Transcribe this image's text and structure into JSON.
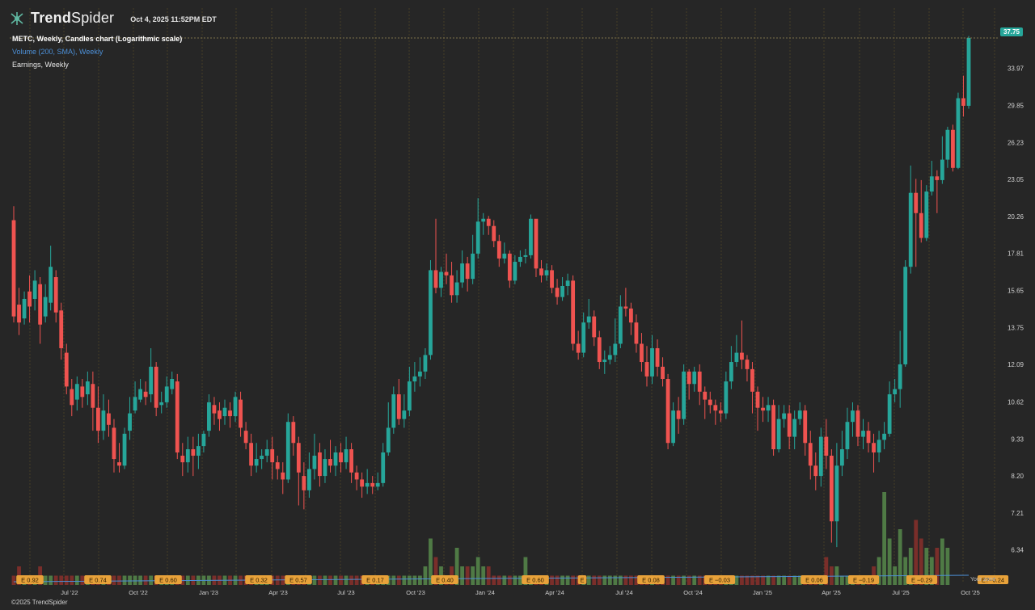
{
  "app": {
    "brand_bold": "Trend",
    "brand_light": "Spider",
    "timestamp": "Oct 4, 2025 11:52PM EDT",
    "copyright": "©2025 TrendSpider",
    "your_zone": "Your zone"
  },
  "legend": {
    "main": "METC, Weekly, Candles chart (Logarithmic scale)",
    "volume": "Volume (200, SMA), Weekly",
    "earnings": "Earnings, Weekly"
  },
  "colors": {
    "up": "#26a69a",
    "down": "#ef5350",
    "background": "#262626",
    "grid": "#6b5a2a",
    "volume_up": "#4f7a45",
    "volume_down": "#7a2e2a",
    "earnings_badge": "#e8a23a"
  },
  "chart_data": {
    "type": "candlestick",
    "symbol": "METC",
    "interval": "Weekly",
    "scale": "log",
    "last_price": "37.75",
    "y_ticks": [
      "37.75",
      "33.97",
      "29.85",
      "26.23",
      "23.05",
      "20.26",
      "17.81",
      "15.65",
      "13.75",
      "12.09",
      "10.62",
      "9.33",
      "8.20",
      "7.21",
      "6.34"
    ],
    "x_ticks": [
      "Jul '22",
      "Oct '22",
      "Jan '23",
      "Apr '23",
      "Jul '23",
      "Oct '23",
      "Jan '24",
      "Apr '24",
      "Jul '24",
      "Oct '24",
      "Jan '25",
      "Apr '25",
      "Jul '25",
      "Oct '25"
    ],
    "y_range": [
      6.0,
      38.5
    ],
    "candles": [
      [
        20.0,
        14.3,
        21.0,
        14.0
      ],
      [
        14.9,
        14.0,
        15.8,
        13.4
      ],
      [
        14.2,
        15.2,
        15.6,
        13.9
      ],
      [
        15.6,
        14.8,
        16.5,
        14.0
      ],
      [
        15.2,
        16.2,
        16.8,
        14.6
      ],
      [
        16.0,
        13.9,
        16.4,
        13.0
      ],
      [
        14.3,
        15.3,
        16.0,
        14.0
      ],
      [
        15.0,
        17.0,
        18.3,
        14.6
      ],
      [
        16.4,
        14.5,
        16.8,
        14.0
      ],
      [
        14.6,
        12.8,
        15.0,
        12.3
      ],
      [
        12.6,
        11.2,
        13.0,
        10.9
      ],
      [
        11.1,
        10.5,
        11.5,
        10.1
      ],
      [
        10.7,
        11.3,
        11.6,
        10.3
      ],
      [
        11.2,
        10.8,
        11.5,
        10.4
      ],
      [
        10.9,
        11.4,
        11.8,
        10.5
      ],
      [
        11.3,
        10.4,
        11.8,
        9.6
      ],
      [
        10.4,
        9.6,
        11.2,
        9.2
      ],
      [
        9.6,
        10.3,
        10.9,
        9.3
      ],
      [
        10.2,
        9.8,
        10.7,
        9.4
      ],
      [
        9.7,
        8.7,
        10.0,
        8.3
      ],
      [
        8.6,
        8.5,
        9.2,
        8.3
      ],
      [
        8.5,
        9.5,
        9.7,
        8.4
      ],
      [
        9.6,
        10.2,
        10.8,
        9.3
      ],
      [
        10.3,
        10.8,
        11.4,
        10.2
      ],
      [
        10.7,
        11.1,
        11.5,
        10.6
      ],
      [
        11.0,
        10.8,
        11.4,
        10.5
      ],
      [
        10.9,
        12.0,
        12.8,
        10.6
      ],
      [
        12.0,
        10.4,
        12.2,
        10.1
      ],
      [
        10.5,
        10.6,
        11.0,
        10.2
      ],
      [
        10.6,
        11.2,
        11.6,
        10.4
      ],
      [
        11.1,
        11.5,
        11.8,
        10.9
      ],
      [
        11.4,
        8.9,
        11.7,
        8.7
      ],
      [
        8.8,
        8.6,
        9.2,
        8.2
      ],
      [
        8.6,
        9.0,
        9.4,
        8.3
      ],
      [
        9.0,
        8.8,
        9.4,
        8.2
      ],
      [
        8.8,
        9.1,
        9.5,
        8.4
      ],
      [
        9.1,
        9.5,
        9.6,
        8.9
      ],
      [
        9.6,
        10.6,
        10.9,
        9.4
      ],
      [
        10.5,
        10.2,
        10.8,
        9.8
      ],
      [
        10.3,
        10.0,
        10.6,
        9.6
      ],
      [
        10.1,
        10.4,
        10.7,
        9.8
      ],
      [
        10.3,
        10.1,
        10.6,
        9.7
      ],
      [
        10.1,
        10.8,
        11.0,
        9.9
      ],
      [
        10.7,
        9.7,
        11.0,
        9.4
      ],
      [
        9.6,
        9.2,
        9.9,
        9.0
      ],
      [
        9.2,
        8.5,
        9.5,
        8.2
      ],
      [
        8.5,
        8.7,
        9.2,
        8.3
      ],
      [
        8.7,
        8.8,
        9.0,
        8.4
      ],
      [
        8.8,
        9.0,
        9.3,
        8.6
      ],
      [
        9.0,
        8.6,
        9.4,
        8.1
      ],
      [
        8.6,
        8.4,
        8.8,
        8.1
      ],
      [
        8.3,
        8.1,
        8.6,
        7.7
      ],
      [
        8.1,
        9.9,
        10.2,
        8.0
      ],
      [
        9.9,
        9.2,
        10.1,
        8.8
      ],
      [
        9.2,
        8.3,
        9.4,
        7.4
      ],
      [
        8.2,
        7.8,
        8.6,
        7.3
      ],
      [
        7.8,
        8.4,
        8.9,
        7.6
      ],
      [
        8.4,
        8.8,
        9.5,
        8.1
      ],
      [
        8.9,
        8.2,
        9.2,
        7.9
      ],
      [
        8.2,
        8.7,
        9.0,
        8.0
      ],
      [
        8.7,
        8.5,
        9.3,
        8.3
      ],
      [
        8.5,
        8.9,
        9.1,
        8.2
      ],
      [
        8.9,
        8.6,
        9.2,
        8.3
      ],
      [
        8.6,
        9.0,
        9.4,
        8.4
      ],
      [
        9.0,
        8.3,
        9.2,
        8.0
      ],
      [
        8.3,
        8.1,
        8.5,
        7.8
      ],
      [
        8.1,
        7.9,
        8.3,
        7.6
      ],
      [
        7.9,
        8.0,
        8.4,
        7.7
      ],
      [
        8.0,
        7.9,
        8.2,
        7.7
      ],
      [
        7.9,
        8.0,
        8.3,
        7.8
      ],
      [
        8.0,
        8.9,
        9.2,
        7.9
      ],
      [
        8.9,
        9.7,
        10.6,
        8.8
      ],
      [
        9.7,
        10.9,
        11.2,
        9.5
      ],
      [
        10.9,
        10.0,
        11.5,
        9.8
      ],
      [
        10.0,
        10.3,
        10.9,
        9.7
      ],
      [
        10.3,
        11.4,
        12.0,
        10.1
      ],
      [
        11.4,
        11.6,
        12.2,
        11.0
      ],
      [
        11.6,
        11.8,
        12.4,
        11.2
      ],
      [
        11.8,
        12.5,
        12.8,
        11.5
      ],
      [
        12.5,
        16.8,
        17.4,
        12.3
      ],
      [
        16.8,
        15.8,
        20.1,
        15.5
      ],
      [
        15.8,
        16.7,
        17.0,
        15.3
      ],
      [
        16.7,
        16.5,
        17.8,
        16.0
      ],
      [
        16.5,
        15.4,
        17.3,
        15.0
      ],
      [
        15.4,
        16.1,
        16.8,
        15.0
      ],
      [
        16.1,
        17.2,
        18.0,
        15.8
      ],
      [
        17.2,
        16.3,
        17.6,
        15.6
      ],
      [
        16.3,
        17.8,
        19.0,
        16.0
      ],
      [
        17.8,
        19.9,
        21.6,
        17.5
      ],
      [
        19.9,
        20.1,
        20.5,
        19.0
      ],
      [
        20.1,
        19.6,
        20.3,
        19.0
      ],
      [
        19.6,
        18.6,
        20.0,
        18.2
      ],
      [
        18.6,
        17.5,
        19.0,
        17.0
      ],
      [
        17.5,
        17.8,
        18.5,
        17.2
      ],
      [
        17.8,
        16.2,
        18.0,
        15.8
      ],
      [
        16.2,
        17.3,
        17.7,
        16.0
      ],
      [
        17.3,
        17.6,
        18.0,
        17.0
      ],
      [
        17.6,
        17.7,
        18.1,
        17.2
      ],
      [
        17.7,
        20.1,
        20.4,
        17.5
      ],
      [
        20.1,
        16.9,
        20.0,
        16.4
      ],
      [
        16.9,
        16.5,
        17.4,
        16.1
      ],
      [
        16.5,
        16.8,
        17.2,
        16.2
      ],
      [
        16.8,
        15.8,
        17.1,
        15.5
      ],
      [
        15.8,
        15.3,
        16.3,
        14.9
      ],
      [
        15.3,
        15.9,
        16.4,
        15.1
      ],
      [
        15.9,
        16.2,
        16.6,
        15.4
      ],
      [
        16.2,
        13.0,
        16.5,
        12.7
      ],
      [
        13.0,
        12.6,
        13.6,
        12.3
      ],
      [
        12.6,
        14.0,
        14.5,
        12.4
      ],
      [
        14.0,
        14.3,
        15.2,
        13.7
      ],
      [
        14.3,
        13.3,
        14.6,
        12.9
      ],
      [
        13.3,
        12.2,
        13.6,
        11.9
      ],
      [
        12.2,
        12.3,
        12.7,
        11.7
      ],
      [
        12.3,
        12.5,
        12.9,
        12.1
      ],
      [
        12.5,
        13.0,
        14.2,
        12.2
      ],
      [
        13.0,
        14.8,
        15.4,
        12.8
      ],
      [
        14.8,
        14.7,
        15.8,
        14.3
      ],
      [
        14.7,
        14.0,
        15.0,
        13.4
      ],
      [
        14.0,
        13.0,
        14.4,
        12.6
      ],
      [
        13.0,
        12.2,
        13.5,
        11.8
      ],
      [
        12.2,
        11.6,
        12.9,
        11.2
      ],
      [
        11.6,
        12.8,
        13.4,
        11.3
      ],
      [
        12.8,
        12.0,
        13.2,
        11.6
      ],
      [
        12.0,
        11.5,
        12.4,
        11.2
      ],
      [
        11.5,
        9.2,
        11.7,
        9.0
      ],
      [
        9.2,
        10.3,
        10.6,
        9.1
      ],
      [
        10.3,
        10.0,
        10.8,
        9.5
      ],
      [
        10.0,
        11.8,
        12.1,
        9.8
      ],
      [
        11.8,
        11.3,
        11.9,
        10.7
      ],
      [
        11.3,
        11.8,
        12.0,
        11.0
      ],
      [
        11.8,
        11.0,
        12.1,
        10.5
      ],
      [
        11.0,
        10.7,
        11.2,
        10.0
      ],
      [
        10.7,
        10.5,
        11.0,
        10.2
      ],
      [
        10.5,
        10.3,
        10.7,
        9.8
      ],
      [
        10.3,
        10.2,
        10.6,
        9.9
      ],
      [
        10.2,
        11.4,
        11.8,
        10.0
      ],
      [
        11.4,
        12.2,
        12.9,
        11.1
      ],
      [
        12.2,
        12.6,
        13.4,
        12.0
      ],
      [
        12.6,
        12.3,
        14.1,
        11.9
      ],
      [
        12.3,
        11.9,
        12.5,
        11.4
      ],
      [
        11.9,
        11.0,
        12.2,
        10.2
      ],
      [
        11.0,
        10.4,
        11.2,
        9.6
      ],
      [
        10.4,
        10.3,
        10.8,
        9.9
      ],
      [
        10.3,
        10.5,
        10.8,
        9.9
      ],
      [
        10.5,
        9.0,
        10.7,
        8.8
      ],
      [
        9.0,
        10.0,
        10.5,
        8.9
      ],
      [
        10.0,
        10.2,
        10.5,
        9.7
      ],
      [
        10.2,
        9.4,
        10.5,
        9.0
      ],
      [
        9.4,
        10.0,
        10.3,
        9.0
      ],
      [
        10.0,
        10.3,
        10.6,
        9.8
      ],
      [
        10.3,
        9.2,
        10.5,
        8.8
      ],
      [
        9.2,
        8.5,
        9.6,
        8.1
      ],
      [
        8.5,
        8.2,
        8.9,
        7.8
      ],
      [
        8.2,
        9.4,
        9.7,
        7.9
      ],
      [
        9.4,
        8.8,
        10.0,
        8.4
      ],
      [
        8.8,
        7.0,
        9.0,
        6.5
      ],
      [
        7.0,
        8.5,
        9.2,
        6.4
      ],
      [
        8.5,
        9.0,
        9.6,
        8.2
      ],
      [
        9.0,
        9.9,
        10.4,
        8.7
      ],
      [
        9.9,
        10.3,
        10.6,
        9.4
      ],
      [
        10.3,
        9.4,
        10.5,
        9.1
      ],
      [
        9.4,
        9.6,
        10.0,
        9.0
      ],
      [
        9.6,
        9.2,
        9.9,
        8.9
      ],
      [
        9.2,
        8.9,
        9.5,
        8.3
      ],
      [
        8.9,
        9.3,
        9.6,
        8.6
      ],
      [
        9.3,
        9.5,
        9.9,
        9.0
      ],
      [
        9.5,
        10.9,
        11.4,
        9.4
      ],
      [
        10.9,
        11.1,
        11.5,
        10.6
      ],
      [
        11.1,
        12.1,
        13.6,
        10.4
      ],
      [
        12.1,
        17.0,
        17.4,
        12.0
      ],
      [
        17.0,
        22.0,
        24.2,
        16.6
      ],
      [
        22.0,
        20.5,
        23.1,
        17.0
      ],
      [
        20.5,
        18.8,
        23.0,
        18.5
      ],
      [
        18.8,
        22.1,
        22.6,
        18.6
      ],
      [
        22.1,
        23.3,
        24.6,
        21.8
      ],
      [
        23.3,
        23.0,
        23.8,
        20.5
      ],
      [
        23.0,
        24.7,
        26.8,
        22.7
      ],
      [
        24.7,
        27.4,
        27.7,
        24.0
      ],
      [
        27.4,
        24.0,
        27.9,
        23.7
      ],
      [
        24.0,
        30.6,
        31.2,
        23.9
      ],
      [
        30.6,
        29.8,
        33.1,
        28.7
      ],
      [
        29.8,
        37.75,
        38.0,
        29.5
      ]
    ],
    "volume_panel": {
      "label": "Volume (200, SMA), Weekly",
      "values": [
        1,
        2,
        1,
        1,
        1,
        2,
        1,
        1,
        1,
        1,
        1,
        1,
        1,
        1,
        1,
        1,
        1,
        1,
        1,
        1,
        1,
        1,
        1,
        1,
        1,
        1,
        1,
        1,
        1,
        1,
        1,
        1,
        1,
        1,
        1,
        1,
        1,
        1,
        1,
        1,
        1,
        1,
        1,
        1,
        1,
        1,
        1,
        1,
        1,
        1,
        1,
        1,
        1,
        1,
        1,
        1,
        1,
        1,
        1,
        1,
        1,
        1,
        1,
        1,
        1,
        1,
        1,
        1,
        1,
        1,
        1,
        1,
        1,
        1,
        1,
        1,
        1,
        1,
        2,
        5,
        3,
        2,
        1,
        2,
        4,
        2,
        2,
        2,
        3,
        2,
        2,
        1,
        1,
        1,
        1,
        1,
        1,
        3,
        1,
        1,
        1,
        1,
        1,
        1,
        1,
        1,
        1,
        1,
        1,
        1,
        1,
        1,
        1,
        1,
        1,
        1,
        1,
        1,
        1,
        1,
        1,
        1,
        1,
        1,
        1,
        1,
        1,
        1,
        1,
        1,
        1,
        1,
        1,
        1,
        1,
        1,
        1,
        1,
        1,
        1,
        1,
        1,
        1,
        1,
        1,
        1,
        1,
        1,
        1,
        1,
        1,
        1,
        1,
        1,
        3,
        2,
        2,
        1,
        1,
        1,
        1,
        1,
        1,
        2,
        3,
        10,
        5,
        2,
        6,
        3,
        4,
        7,
        5,
        4,
        3,
        4,
        5,
        4
      ]
    },
    "earnings": [
      "E 0.92",
      "E 0.74",
      "E 0.60",
      "E 0.32",
      "E 0.57",
      "E 0.17",
      "E 0.40",
      "E 0.60",
      "E",
      "E 0.08",
      "E −0.03",
      "E 0.06",
      "E −0.19",
      "E −0.29",
      "E?−0.24"
    ]
  }
}
